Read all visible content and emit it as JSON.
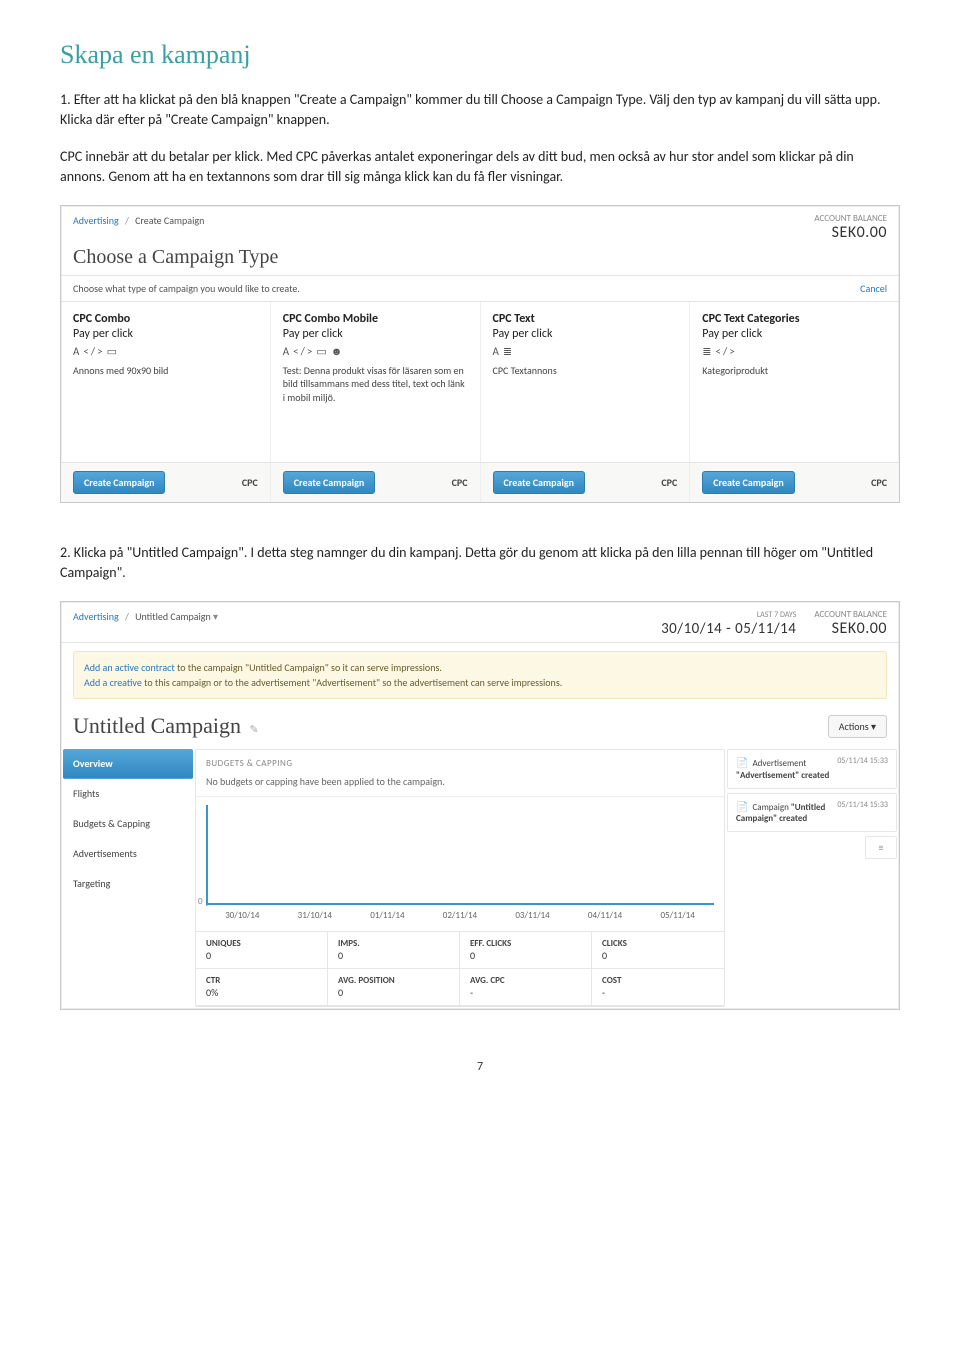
{
  "page": {
    "title": "Skapa en kampanj",
    "step1_a": "1. Efter att ha klickat på den blå knappen \"Create a Campaign\" kommer du till Choose a Campaign Type. Välj den typ av kampanj du vill sätta upp. Klicka där efter på \"Create Campaign\" knappen.",
    "step1_b": "CPC innebär att du betalar per klick. Med CPC påverkas antalet exponeringar dels av ditt bud, men också av hur stor andel som klickar på din annons. Genom att ha en textannons som drar till sig många klick kan du få fler visningar.",
    "step2": "2. Klicka på \"Untitled Campaign\". I detta steg namnger du din kampanj. Detta gör du genom att klicka på den lilla pennan till höger om \"Untitled Campaign\".",
    "number": "7"
  },
  "panel1": {
    "breadcrumb": {
      "root": "Advertising",
      "leaf": "Create Campaign"
    },
    "account": {
      "label": "ACCOUNT BALANCE",
      "value": "SEK0.00"
    },
    "heading": "Choose a Campaign Type",
    "sub": "Choose what type of campaign you would like to create.",
    "cancel": "Cancel",
    "cards": [
      {
        "title": "CPC Combo",
        "subtitle": "Pay per click",
        "desc": "Annons med 90x90 bild"
      },
      {
        "title": "CPC Combo Mobile",
        "subtitle": "Pay per click",
        "desc": "Test: Denna produkt visas för läsaren som en bild tillsammans med dess titel, text och länk i mobil miljö."
      },
      {
        "title": "CPC Text",
        "subtitle": "Pay per click",
        "desc": "CPC Textannons"
      },
      {
        "title": "CPC Text Categories",
        "subtitle": "Pay per click",
        "desc": "Kategoriprodukt"
      }
    ],
    "button": "Create Campaign",
    "tag": "CPC"
  },
  "panel2": {
    "breadcrumb": {
      "root": "Advertising",
      "leaf": "Untitled Campaign"
    },
    "daterange": {
      "label": "LAST 7 DAYS",
      "value": "30/10/14 - 05/11/14"
    },
    "account": {
      "label": "ACCOUNT BALANCE",
      "value": "SEK0.00"
    },
    "notice": {
      "l1a": "Add an active contract",
      "l1b": " to the campaign \"Untitled Campaign\" so it can serve impressions.",
      "l2a": "Add a creative",
      "l2b": " to this campaign or to the advertisement \"Advertisement\" so the advertisement can serve impressions."
    },
    "heading": "Untitled Campaign",
    "actions": "Actions ▾",
    "nav": [
      "Overview",
      "Flights",
      "Budgets & Capping",
      "Advertisements",
      "Targeting"
    ],
    "center": {
      "head": "BUDGETS & CAPPING",
      "body": "No budgets or capping have been applied to the campaign.",
      "zero": "0",
      "xaxis": [
        "30/10/14",
        "31/10/14",
        "01/11/14",
        "02/11/14",
        "03/11/14",
        "04/11/14",
        "05/11/14"
      ]
    },
    "events": [
      {
        "text_a": "Advertisement ",
        "text_b": "\"Advertisement\" created",
        "time": "05/11/14 15:33"
      },
      {
        "text_a": "Campaign ",
        "text_b": "\"Untitled Campaign\" created",
        "time": "05/11/14 15:33"
      }
    ],
    "toggle": "≡",
    "stats": [
      {
        "label": "UNIQUES",
        "value": "0"
      },
      {
        "label": "IMPS.",
        "value": "0"
      },
      {
        "label": "EFF. CLICKS",
        "value": "0"
      },
      {
        "label": "CLICKS",
        "value": "0"
      },
      {
        "label": "CTR",
        "value": "0%"
      },
      {
        "label": "AVG. POSITION",
        "value": "0"
      },
      {
        "label": "AVG. CPC",
        "value": "-"
      },
      {
        "label": "COST",
        "value": "-"
      }
    ]
  },
  "chart_data": {
    "type": "line",
    "categories": [
      "30/10/14",
      "31/10/14",
      "01/11/14",
      "02/11/14",
      "03/11/14",
      "04/11/14",
      "05/11/14"
    ],
    "values": [
      0,
      0,
      0,
      0,
      0,
      0,
      0
    ],
    "ylabel": "",
    "xlabel": "",
    "ylim": [
      0,
      0
    ]
  }
}
